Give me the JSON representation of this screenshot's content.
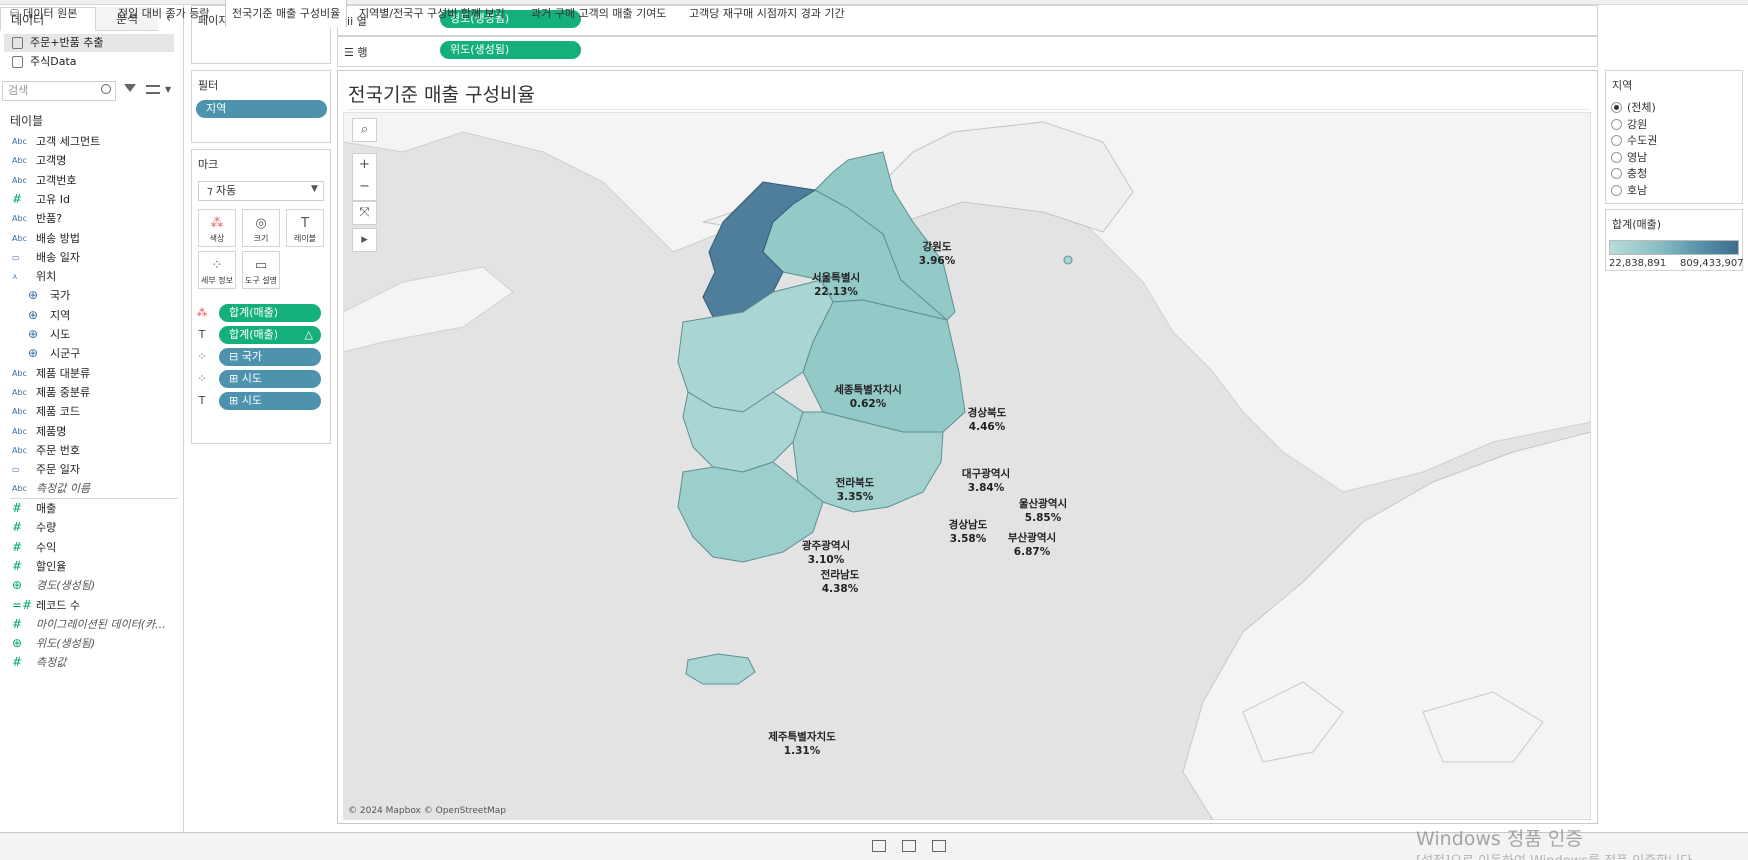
{
  "data_pane": {
    "tab_data": "데이터",
    "tab_analysis": "분석",
    "datasources": [
      "주문+반품 추출",
      "주식Data"
    ],
    "search_placeholder": "검색",
    "tables_heading": "테이블",
    "fields": [
      {
        "type": "Abc",
        "name": "고객 세그먼트"
      },
      {
        "type": "Abc",
        "name": "고객명"
      },
      {
        "type": "Abc",
        "name": "고객번호"
      },
      {
        "type": "#",
        "name": "고유 Id"
      },
      {
        "type": "Abc",
        "name": "반품?"
      },
      {
        "type": "Abc",
        "name": "배송 방법"
      },
      {
        "type": "date",
        "name": "배송 일자"
      },
      {
        "type": "hier",
        "name": "위치"
      },
      {
        "type": "geo",
        "name": "국가"
      },
      {
        "type": "geo",
        "name": "지역"
      },
      {
        "type": "geo",
        "name": "시도"
      },
      {
        "type": "geo",
        "name": "시군구"
      },
      {
        "type": "Abc",
        "name": "제품 대분류"
      },
      {
        "type": "Abc",
        "name": "제품 중분류"
      },
      {
        "type": "Abc",
        "name": "제품 코드"
      },
      {
        "type": "Abc",
        "name": "제품명"
      },
      {
        "type": "Abc",
        "name": "주문 번호"
      },
      {
        "type": "date",
        "name": "주문 일자"
      },
      {
        "type": "Abc",
        "name": "측정값 이름"
      }
    ],
    "measures": [
      {
        "type": "#",
        "name": "매출"
      },
      {
        "type": "#",
        "name": "수량"
      },
      {
        "type": "#",
        "name": "수익"
      },
      {
        "type": "#",
        "name": "할인율"
      },
      {
        "type": "geo",
        "name": "경도(생성됨)"
      },
      {
        "type": "=#",
        "name": "레코드 수"
      },
      {
        "type": "#",
        "name": "마이그레이션된 데이터(카..."
      },
      {
        "type": "geo",
        "name": "위도(생성됨)"
      },
      {
        "type": "#",
        "name": "측정값"
      }
    ]
  },
  "shelves": {
    "pages_title": "페이지",
    "filters_title": "필터",
    "filter_pill": "지역",
    "marks_title": "마크",
    "mark_type": "자동",
    "mark_buttons": [
      "색상",
      "크기",
      "레이블",
      "세부 정보",
      "도구 설명"
    ],
    "mark_pills": [
      "합계(매출)",
      "합계(매출)",
      "국가",
      "시도",
      "시도"
    ],
    "columns_label": "열",
    "columns_pill": "경도(생성됨)",
    "rows_label": "행",
    "rows_pill": "위도(생성됨)"
  },
  "view": {
    "title": "전국기준 매출 구성비율",
    "credit": "© 2024 Mapbox © OpenStreetMap",
    "region_labels": [
      {
        "name": "강원도",
        "value": "3.96%"
      },
      {
        "name": "서울특별시",
        "value": "22.13%"
      },
      {
        "name": "세종특별자치시",
        "value": "0.62%"
      },
      {
        "name": "경상북도",
        "value": "4.46%"
      },
      {
        "name": "대구광역시",
        "value": "3.84%"
      },
      {
        "name": "전라북도",
        "value": "3.35%"
      },
      {
        "name": "울산광역시",
        "value": "5.85%"
      },
      {
        "name": "경상남도",
        "value": "3.58%"
      },
      {
        "name": "부산광역시",
        "value": "6.87%"
      },
      {
        "name": "광주광역시",
        "value": "3.10%"
      },
      {
        "name": "전라남도",
        "value": "4.38%"
      },
      {
        "name": "제주특별자치도",
        "value": "1.31%"
      }
    ]
  },
  "legends": {
    "region_title": "지역",
    "region_options": [
      "(전체)",
      "강원",
      "수도권",
      "영남",
      "충청",
      "호남"
    ],
    "region_selected": "(전체)",
    "color_title": "합계(매출)",
    "color_min": "22,838,891",
    "color_max": "809,433,907",
    "color_low": "#b9dcd7",
    "color_high": "#3b6e90"
  },
  "sheet_tabs": {
    "datasource_tab": "데이터 원본",
    "tabs": [
      "전일 대비 종가 등락",
      "전국기준 매출 구성비율",
      "지역별/전국구 구성비 함께 보기",
      "과거 구매 고객의 매출 기여도",
      "고객당 재구매 시점까지 경과 기간"
    ],
    "active_tab": "전국기준 매출 구성비율"
  },
  "watermark": {
    "line1": "Windows 정품 인증",
    "line2": "[설정]으로 이동하여 Windows를 정품 인증합니다."
  }
}
